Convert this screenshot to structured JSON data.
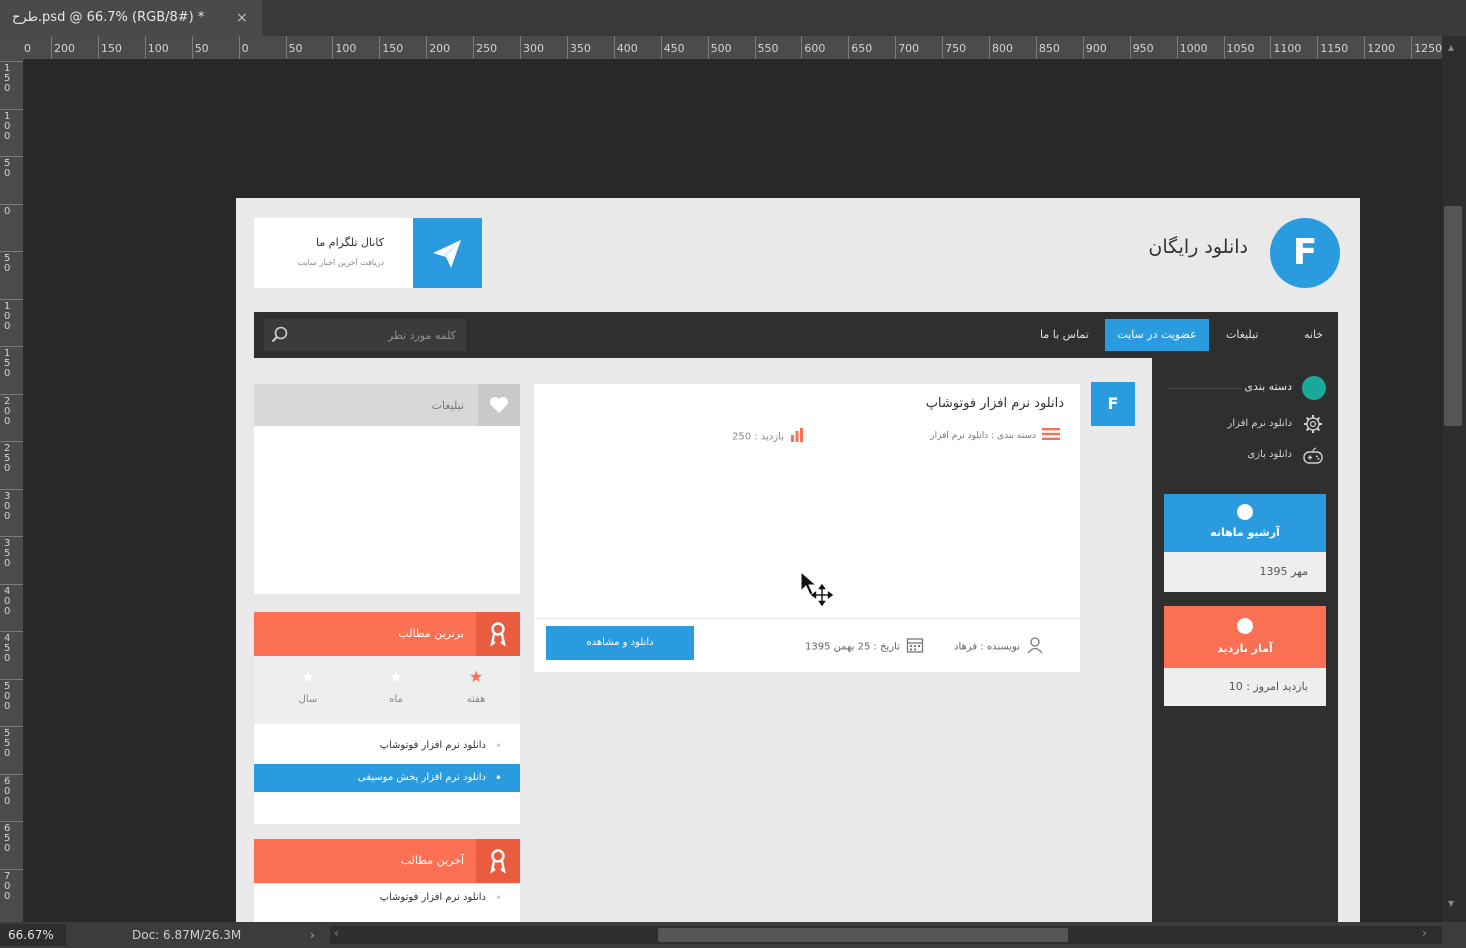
{
  "window": {
    "tab_title": "طرح.psd @ 66.7% (RGB/8#) *",
    "tab_close": "×"
  },
  "ruler": {
    "h_ticks": [
      "0",
      "200",
      "150",
      "100",
      "50",
      "0",
      "50",
      "100",
      "150",
      "200",
      "250",
      "300",
      "350",
      "400",
      "450",
      "500",
      "550",
      "600",
      "650",
      "700",
      "750",
      "800",
      "850",
      "900",
      "950",
      "1000",
      "1050",
      "1100",
      "1150",
      "1200",
      "1250"
    ],
    "v_ticks": [
      "150",
      "100",
      "50",
      "0",
      "50",
      "100",
      "150",
      "200",
      "250",
      "300",
      "350",
      "400",
      "450",
      "500",
      "550",
      "600",
      "650",
      "700"
    ]
  },
  "status": {
    "zoom": "66.67%",
    "doc": "Doc: 6.87M/26.3M"
  },
  "site": {
    "logo_letter": "F",
    "title": "دانلود رایگان",
    "telegram_title": "کانال تلگرام ما",
    "telegram_sub": "دریافت آخرین اخبار سایت"
  },
  "nav": {
    "home": "خانه",
    "ads": "تبلیغات",
    "join": "عضویت در سایت",
    "contact": "تماس با ما",
    "search_placeholder": "کلمه مورد نظر"
  },
  "sidebar": {
    "category_title": "دسته بندی",
    "items": [
      {
        "label": "دانلود نرم افزار",
        "icon": "gear-icon"
      },
      {
        "label": "دانلود بازی",
        "icon": "gamepad-icon"
      }
    ],
    "archive": {
      "title": "آرشیو ماهانه",
      "value": "مهر 1395"
    },
    "stats": {
      "title": "آمار بازدید",
      "value": "بازدید امروز : 10"
    }
  },
  "post": {
    "badge": "F",
    "title": "دانلود نرم افزار فوتوشاپ",
    "category": "دسته بندی : دانلود نرم افزار",
    "views": "بازدید : 250",
    "author": "نویسنده : فرهاد",
    "date": "تاریخ : 25 بهمن 1395",
    "button": "دانلود و مشاهده"
  },
  "ads_box": {
    "title": "تبلیغات"
  },
  "top_posts": {
    "title": "برترین مطالب",
    "tabs": [
      {
        "label": "هفته",
        "active": true
      },
      {
        "label": "ماه",
        "active": false
      },
      {
        "label": "سال",
        "active": false
      }
    ],
    "items": [
      "دانلود نرم افزار فوتوشاپ",
      "دانلود نرم افزار پخش موسیقی"
    ]
  },
  "latest_posts": {
    "title": "آخرین مطالب",
    "items": [
      "دانلود نرم افزار فوتوشاپ"
    ]
  },
  "colors": {
    "accent_blue": "#2b9be0",
    "accent_orange": "#fb6f52",
    "teal": "#1aa89a",
    "dark_nav": "#2f2f2f"
  }
}
